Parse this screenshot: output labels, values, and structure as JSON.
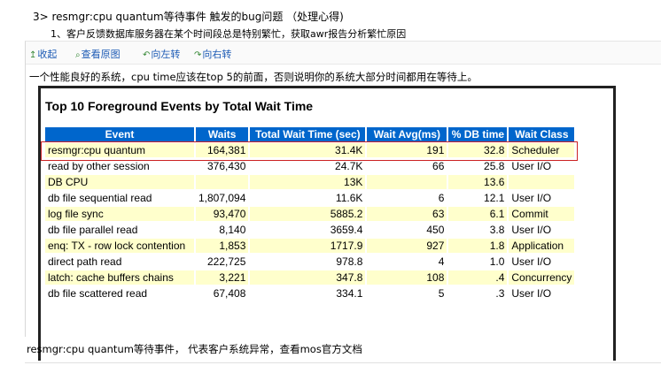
{
  "heading": "3>  resmgr:cpu quantum等待事件 触发的bug问题  （处理心得)",
  "subheading": "1、客户反馈数据库服务器在某个时间段总是特别繁忙，获取awr报告分析繁忙原因",
  "toolbar": {
    "collapse": "收起",
    "view_original": "查看原图",
    "rotate_left": "向左转",
    "rotate_right": "向右转"
  },
  "intro": "一个性能良好的系统，cpu time应该在top 5的前面，否则说明你的系统大部分时间都用在等待上。",
  "report": {
    "title": "Top 10 Foreground Events by Total Wait Time",
    "columns": [
      "Event",
      "Waits",
      "Total Wait Time (sec)",
      "Wait Avg(ms)",
      "% DB time",
      "Wait Class"
    ],
    "rows": [
      [
        "resmgr:cpu quantum",
        "164,381",
        "31.4K",
        "191",
        "32.8",
        "Scheduler"
      ],
      [
        "read by other session",
        "376,430",
        "24.7K",
        "66",
        "25.8",
        "User I/O"
      ],
      [
        "DB CPU",
        "",
        "13K",
        "",
        "13.6",
        ""
      ],
      [
        "db file sequential read",
        "1,807,094",
        "11.6K",
        "6",
        "12.1",
        "User I/O"
      ],
      [
        "log file sync",
        "93,470",
        "5885.2",
        "63",
        "6.1",
        "Commit"
      ],
      [
        "db file parallel read",
        "8,140",
        "3659.4",
        "450",
        "3.8",
        "User I/O"
      ],
      [
        "enq: TX - row lock contention",
        "1,853",
        "1717.9",
        "927",
        "1.8",
        "Application"
      ],
      [
        "direct path read",
        "222,725",
        "978.8",
        "4",
        "1.0",
        "User I/O"
      ],
      [
        "latch: cache buffers chains",
        "3,221",
        "347.8",
        "108",
        ".4",
        "Concurrency"
      ],
      [
        "db file scattered read",
        "67,408",
        "334.1",
        "5",
        ".3",
        "User I/O"
      ]
    ]
  },
  "footer": "resmgr:cpu quantum等待事件， 代表客户系统异常，查看mos官方文档",
  "icons": {
    "collapse": "arrow-up-icon",
    "view_original": "magnifier-icon",
    "rotate_left": "rotate-left-icon",
    "rotate_right": "rotate-right-icon"
  },
  "colors": {
    "header_bg": "#0066cc",
    "row_highlight": "#ffffcc",
    "selection_border": "#cc2222",
    "link": "#1d5bb5"
  }
}
